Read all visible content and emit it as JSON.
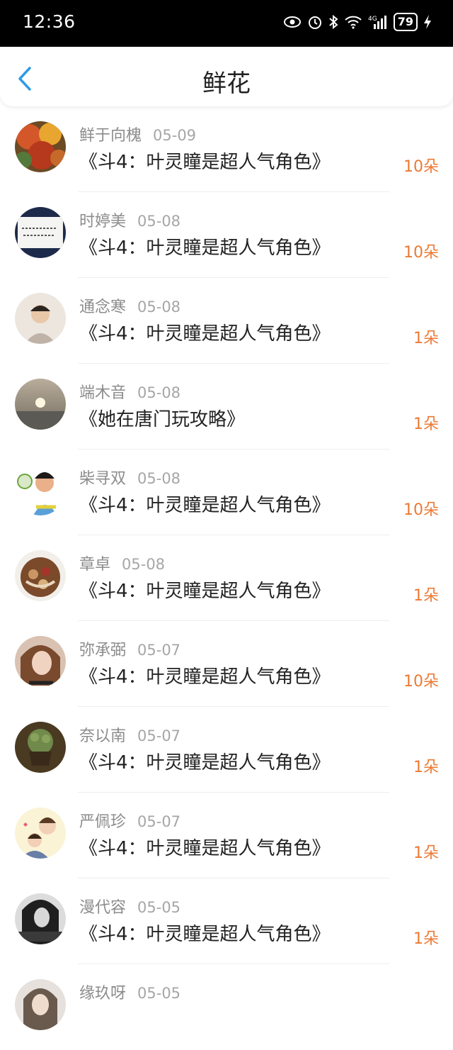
{
  "status": {
    "time": "12:36",
    "battery": "79",
    "network": "4G"
  },
  "header": {
    "title": "鲜花"
  },
  "items": [
    {
      "name": "鲜于向槐",
      "date": "05-09",
      "title": "《斗4：叶灵瞳是超人气角色》",
      "amount": "10朵"
    },
    {
      "name": "时婷美",
      "date": "05-08",
      "title": "《斗4：叶灵瞳是超人气角色》",
      "amount": "10朵"
    },
    {
      "name": "通念寒",
      "date": "05-08",
      "title": "《斗4：叶灵瞳是超人气角色》",
      "amount": "1朵"
    },
    {
      "name": "端木音",
      "date": "05-08",
      "title": "《她在唐门玩攻略》",
      "amount": "1朵"
    },
    {
      "name": "柴寻双",
      "date": "05-08",
      "title": "《斗4：叶灵瞳是超人气角色》",
      "amount": "10朵"
    },
    {
      "name": "章卓",
      "date": "05-08",
      "title": "《斗4：叶灵瞳是超人气角色》",
      "amount": "1朵"
    },
    {
      "name": "弥承弼",
      "date": "05-07",
      "title": "《斗4：叶灵瞳是超人气角色》",
      "amount": "10朵"
    },
    {
      "name": "奈以南",
      "date": "05-07",
      "title": "《斗4：叶灵瞳是超人气角色》",
      "amount": "1朵"
    },
    {
      "name": "严佩珍",
      "date": "05-07",
      "title": "《斗4：叶灵瞳是超人气角色》",
      "amount": "1朵"
    },
    {
      "name": "漫代容",
      "date": "05-05",
      "title": "《斗4：叶灵瞳是超人气角色》",
      "amount": "1朵"
    },
    {
      "name": "缘玖呀",
      "date": "05-05",
      "title": "",
      "amount": ""
    }
  ],
  "colors": {
    "accent": "#ec7a35",
    "back": "#2f9be6"
  }
}
